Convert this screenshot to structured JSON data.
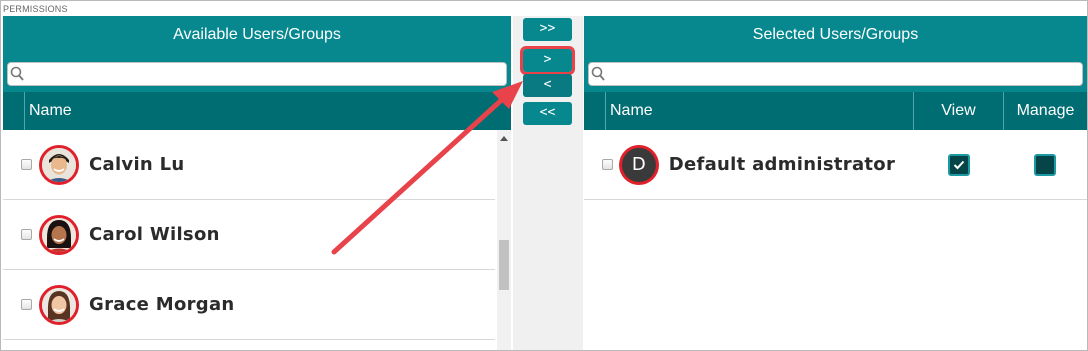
{
  "section": {
    "label": "PERMISSIONS"
  },
  "available": {
    "title": "Available Users/Groups",
    "search_placeholder": "",
    "column_name": "Name",
    "users": [
      {
        "name": "Calvin Lu",
        "checked": false,
        "avatar": "photo"
      },
      {
        "name": "Carol Wilson",
        "checked": false,
        "avatar": "photo"
      },
      {
        "name": "Grace Morgan",
        "checked": false,
        "avatar": "photo"
      }
    ]
  },
  "transfer": {
    "add_all_label": ">>",
    "add_label": ">",
    "remove_label": "<",
    "remove_all_label": "<<"
  },
  "selected": {
    "title": "Selected Users/Groups",
    "search_placeholder": "",
    "column_name": "Name",
    "column_view": "View",
    "column_manage": "Manage",
    "users": [
      {
        "name": "Default administrator",
        "initial": "D",
        "checked": false,
        "view": true,
        "manage": false
      }
    ]
  },
  "colors": {
    "header_teal": "#07888f",
    "column_header_teal": "#006d73",
    "highlight_red": "#e8434b",
    "avatar_border": "#e0202a"
  },
  "annotation": {
    "arrow": "red-arrow pointing to add button"
  }
}
